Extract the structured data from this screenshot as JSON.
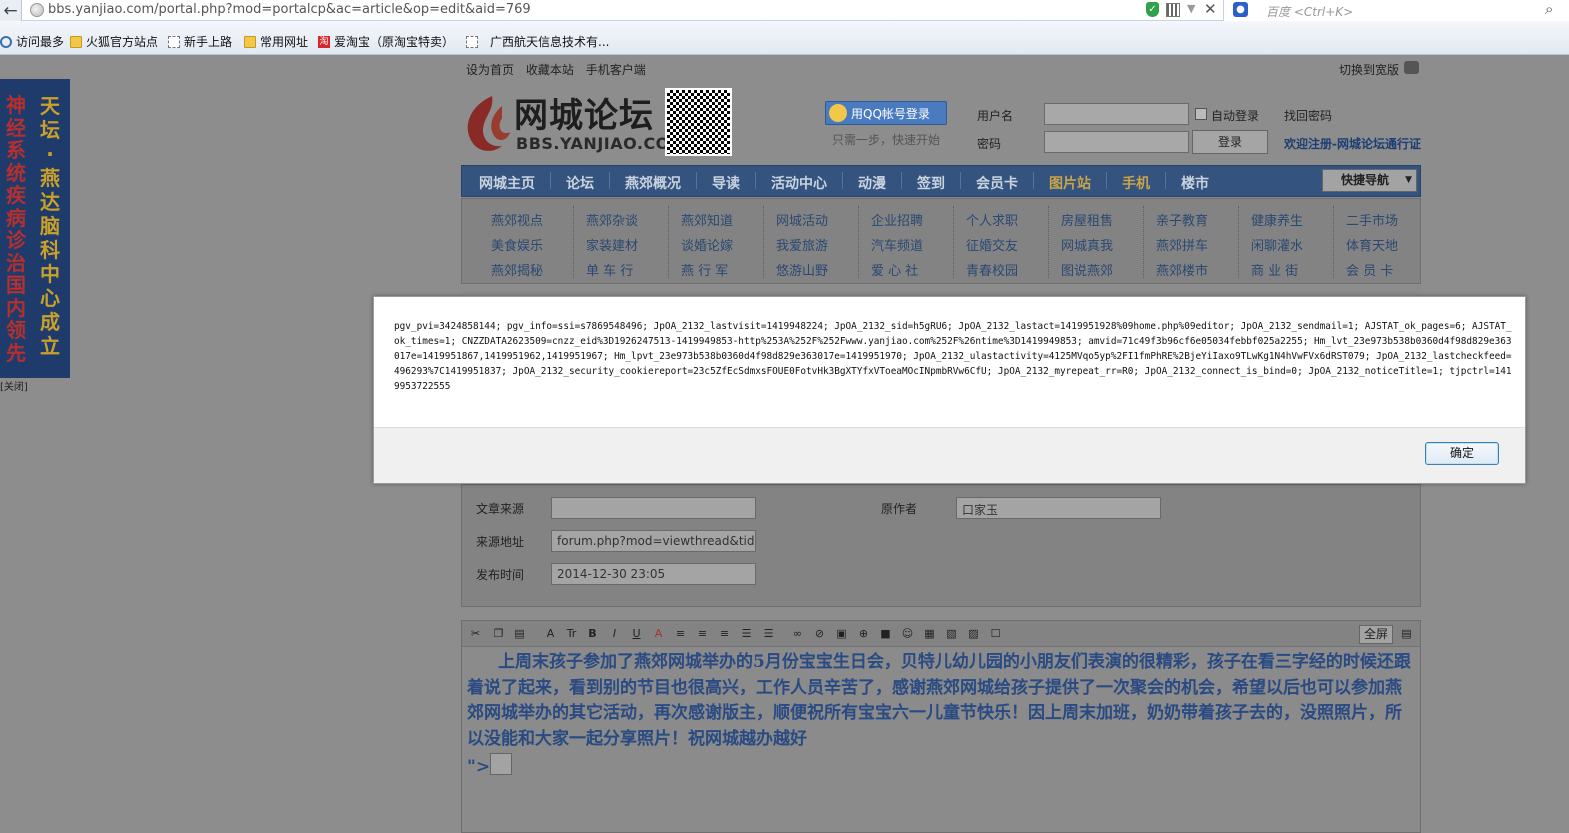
{
  "browser": {
    "url": "bbs.yanjiao.com/portal.php?mod=portalcp&ac=article&op=edit&aid=769",
    "search_placeholder": "百度 <Ctrl+K>",
    "bookmarks": [
      "访问最多",
      "火狐官方站点",
      "新手上路",
      "常用网址",
      "爱淘宝（原淘宝特卖）",
      "广西航天信息技术有..."
    ]
  },
  "site": {
    "top_links": [
      "设为首页",
      "收藏本站",
      "手机客户端"
    ],
    "wide_toggle": "切换到宽版",
    "logo_title": "网城论坛",
    "logo_sub": "BBS.YANJIAO.COM",
    "qq_login": "用QQ帐号登录",
    "qq_tip": "只需一步，快速开始",
    "username_label": "用户名",
    "password_label": "密码",
    "auto_login": "自动登录",
    "find_password": "找回密码",
    "login_button": "登录",
    "register_link": "欢迎注册-网城论坛通行证",
    "nav": [
      "网城主页",
      "论坛",
      "燕郊概况",
      "导读",
      "活动中心",
      "动漫",
      "签到",
      "会员卡",
      "图片站",
      "手机",
      "楼市"
    ],
    "quick_nav": "快捷导航",
    "subnav": [
      [
        "燕郊视点",
        "美食娱乐",
        "燕郊揭秘"
      ],
      [
        "燕郊杂谈",
        "家装建材",
        "单 车 行"
      ],
      [
        "燕郊知道",
        "谈婚论嫁",
        "燕 行 军"
      ],
      [
        "网城活动",
        "我爱旅游",
        "悠游山野"
      ],
      [
        "企业招聘",
        "汽车频道",
        "爱 心 社"
      ],
      [
        "个人求职",
        "征婚交友",
        "青春校园"
      ],
      [
        "房屋租售",
        "网城真我",
        "图说燕郊"
      ],
      [
        "亲子教育",
        "燕郊拼车",
        "燕郊楼市"
      ],
      [
        "健康养生",
        "闲聊灌水",
        "商 业 街"
      ],
      [
        "二手市场",
        "体育天地",
        "会 员 卡"
      ]
    ]
  },
  "ad": {
    "col1": "神经系统疾病诊治国内领先",
    "col2": "天坛·燕达脑科中心成立",
    "close": "[关闭]"
  },
  "form": {
    "source_label": "文章来源",
    "source_value": "",
    "author_label": "原作者",
    "author_value": "口家玉",
    "url_label": "来源地址",
    "url_value": "forum.php?mod=viewthread&tid=4",
    "time_label": "发布时间",
    "time_value": "2014-12-30 23:05"
  },
  "editor": {
    "fullscreen": "全屏",
    "content": "上周末孩子参加了燕郊网城举办的5月份宝宝生日会，贝特儿幼儿园的小朋友们表演的很精彩，孩子在看三字经的时候还跟着说了起来，看到别的节目也很高兴，工作人员辛苦了，感谢燕郊网城给孩子提供了一次聚会的机会，希望以后也可以参加燕郊网城举办的其它活动，再次感谢版主，顺便祝所有宝宝六一儿童节快乐！因上周末加班，奶奶带着孩子去的，没照照片，所以没能和大家一起分享照片！祝网城越办越好",
    "tail": "\">"
  },
  "dialog": {
    "message": "pgv_pvi=3424858144; pgv_info=ssi=s7869548496; JpOA_2132_lastvisit=1419948224; JpOA_2132_sid=h5gRU6; JpOA_2132_lastact=1419951928%09home.php%09editor; JpOA_2132_sendmail=1; AJSTAT_ok_pages=6; AJSTAT_ok_times=1; CNZZDATA2623509=cnzz_eid%3D1926247513-1419949853-http%253A%252F%252Fwww.yanjiao.com%252F%26ntime%3D1419949853; amvid=71c49f3b96cf6e05034febbf025a2255; Hm_lvt_23e973b538b0360d4f98d829e363017e=1419951867,1419951962,1419951967; Hm_lpvt_23e973b538b0360d4f98d829e363017e=1419951970; JpOA_2132_ulastactivity=4125MVqo5yp%2FI1fmPhRE%2BjeYiIaxo9TLwKg1N4hVwFVx6dRST079; JpOA_2132_lastcheckfeed=496293%7C1419951837; JpOA_2132_security_cookiereport=23c5ZfEcSdmxsFOUE0FotvHk3BgXTYfxVToeaMOcINpmbRVw6CfU; JpOA_2132_myrepeat_rr=R0; JpOA_2132_connect_is_bind=0; JpOA_2132_noticeTitle=1; tjpctrl=1419953722555",
    "ok_button": "确定"
  }
}
